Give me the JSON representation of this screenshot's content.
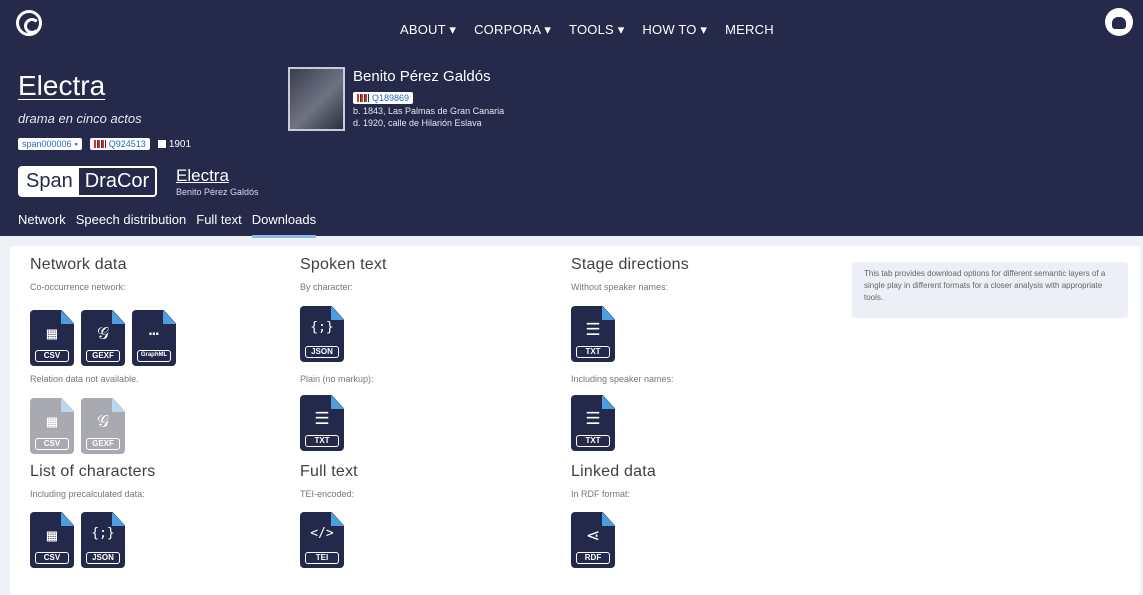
{
  "nav": {
    "items": [
      "ABOUT ▾",
      "CORPORA ▾",
      "TOOLS ▾",
      "HOW TO ▾",
      "MERCH"
    ]
  },
  "play": {
    "title": "Electra",
    "subtitle": "drama en cinco actos",
    "id": "span000006",
    "wikidata": "Q924513",
    "year": "1901"
  },
  "author": {
    "name": "Benito Pérez Galdós",
    "wikidata": "Q189869",
    "born": "b. 1843, Las Palmas de Gran Canaria",
    "died": "d. 1920, calle de Hilarión Eslava"
  },
  "corpus": {
    "a": "Span",
    "b": "DraCor",
    "play_title": "Electra",
    "play_author": "Benito Pérez Galdós"
  },
  "tabs": [
    "Network",
    "Speech distribution",
    "Full text",
    "Downloads"
  ],
  "sections": {
    "network": {
      "title": "Network data",
      "label1": "Co-occurrence network:",
      "label2": "Relation data not available."
    },
    "characters": {
      "title": "List of characters",
      "label": "Including precalculated data:"
    },
    "spoken": {
      "title": "Spoken text",
      "label1": "By character:",
      "label2": "Plain (no markup):"
    },
    "fulltext": {
      "title": "Full text",
      "label": "TEI-encoded:"
    },
    "stage": {
      "title": "Stage directions",
      "label1": "Without speaker names:",
      "label2": "Including speaker names:"
    },
    "linked": {
      "title": "Linked data",
      "label": "In RDF format:"
    }
  },
  "files": {
    "csv": "CSV",
    "gexf": "GEXF",
    "graphml": "GraphML",
    "json": "JSON",
    "txt": "TXT",
    "tei": "TEI",
    "rdf": "RDF",
    "g_csv": "▦",
    "g_gexf": "𝒢",
    "g_graphml": "⋯",
    "g_json": "{;}",
    "g_txt": "☰",
    "g_tei": "</>",
    "g_rdf": "⋖"
  },
  "info": "This tab provides download options for different semantic layers of a single play in different formats for a closer analysis with appropriate tools.",
  "colors": {
    "header": "#25294a",
    "accent": "#4b9fe0"
  }
}
